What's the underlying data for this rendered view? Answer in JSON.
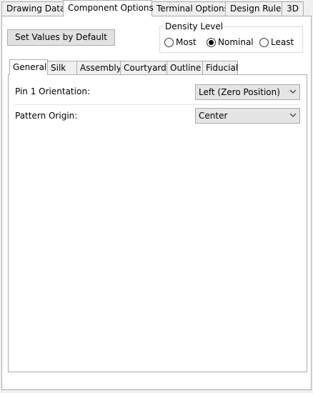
{
  "top_tabs": [
    {
      "label": "Drawing Data",
      "active": false
    },
    {
      "label": "Component Options",
      "active": true
    },
    {
      "label": "Terminal Options",
      "active": false
    },
    {
      "label": "Design Rules",
      "active": false
    },
    {
      "label": "3D",
      "active": false
    }
  ],
  "set_default_button": "Set Values by Default",
  "density": {
    "legend": "Density Level",
    "options": [
      {
        "label": "Most",
        "checked": false
      },
      {
        "label": "Nominal",
        "checked": true
      },
      {
        "label": "Least",
        "checked": false
      }
    ]
  },
  "inner_tabs": [
    {
      "label": "General",
      "active": true
    },
    {
      "label": "Silk",
      "active": false
    },
    {
      "label": "Assembly",
      "active": false
    },
    {
      "label": "Courtyard",
      "active": false
    },
    {
      "label": "Outline",
      "active": false
    },
    {
      "label": "Fiducial",
      "active": false
    }
  ],
  "general": {
    "pin1": {
      "label": "Pin 1 Orientation:",
      "value": "Left (Zero Position)"
    },
    "origin": {
      "label": "Pattern Origin:",
      "value": "Center"
    }
  },
  "icons": {
    "dropdown": "chevron-down-icon"
  }
}
